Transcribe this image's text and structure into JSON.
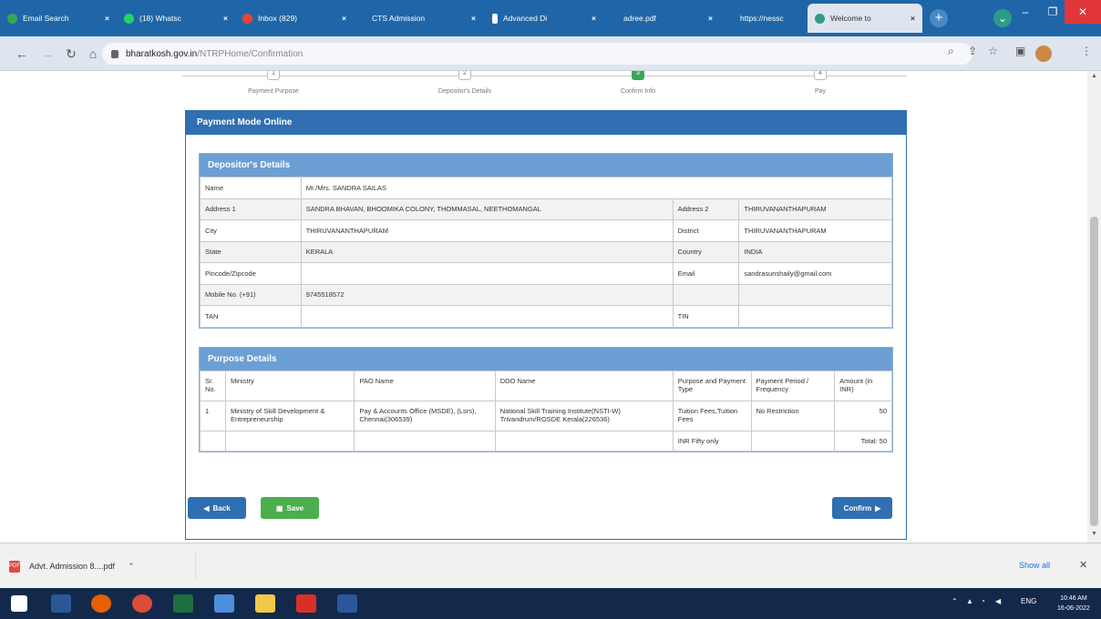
{
  "browser": {
    "tabs": [
      {
        "label": "Email Search",
        "active": false,
        "color": "#34a853"
      },
      {
        "label": "(18) Whatsc",
        "active": false,
        "color": "#25d366"
      },
      {
        "label": "Inbox (829)",
        "active": false,
        "color": "#ea4335"
      },
      {
        "label": "CTS Admission",
        "active": false,
        "color": "#ffffff"
      },
      {
        "label": "Advanced Di",
        "active": false,
        "color": "#ffffff"
      },
      {
        "label": "adree.pdf",
        "active": false,
        "color": "#ffffff"
      },
      {
        "label": "https://nessc",
        "active": false,
        "color": "#ffffff"
      },
      {
        "label": "Welcome to",
        "active": true,
        "color": "#2e9a8a"
      }
    ],
    "url_host": "bharatkosh.gov.in",
    "url_path": "/NTRPHome/Confirmation"
  },
  "stepper": {
    "steps": [
      {
        "num": "1",
        "label": "Payment Purpose"
      },
      {
        "num": "2",
        "label": "Depositor's Details"
      },
      {
        "num": "3",
        "label": "Confirm Info"
      },
      {
        "num": "4",
        "label": "Pay"
      }
    ]
  },
  "panel": {
    "title": "Payment Mode Online",
    "depositor": {
      "title": "Depositor's Details",
      "name_label": "Name",
      "name_value": "Mr./Mrs. SANDRA SAILAS",
      "address1_label": "Address 1",
      "address1_value": "SANDRA BHAVAN, BHOOMIKA COLONY, THOMMASAL, NEETHOMANGAL",
      "address2_label": "Address 2",
      "address2_value": "THIRUVANANTHAPURAM",
      "city_label": "City",
      "city_value": "THIRUVANANTHAPURAM",
      "district_label": "District",
      "district_value": "THIRUVANANTHAPURAM",
      "state_label": "State",
      "state_value": "KERALA",
      "country_label": "Country",
      "country_value": "INDIA",
      "pincode_label": "Pincode/Zipcode",
      "pincode_value": "",
      "email_label": "Email",
      "email_value": "sandrasunshaily@gmail.com",
      "mobile_label": "Mobile No. (+91)",
      "mobile_value": "9745518572",
      "tan_label": "TAN",
      "tan_value": "",
      "tin_label": "TIN",
      "tin_value": ""
    },
    "purpose": {
      "title": "Purpose Details",
      "headers": [
        "Sr. No.",
        "Ministry",
        "PAO Name",
        "DDO Name",
        "Purpose and Payment Type",
        "Payment Period / Frequency",
        "Amount (in INR)"
      ],
      "rows": [
        {
          "sr": "1",
          "ministry": "Ministry of Skill Development & Entrepreneurship",
          "pao": "Pay & Accounts Office (MSDE), (Lsrs), Chennai(306539)",
          "ddo": "National Skill Training Institute(NSTI-W) Trivandrum/ROSDE Kerala(226536)",
          "purpose": "Tuition Fees,Tuition Fees",
          "period": "No Restriction",
          "amount": "50"
        }
      ],
      "total_words": "INR Fifty only",
      "total_amount": "Total: 50"
    },
    "buttons": {
      "back": "Back",
      "save": "Save",
      "confirm": "Confirm"
    }
  },
  "download": {
    "file": "Advt. Admission 8....pdf",
    "show_all": "Show all"
  },
  "taskbar": {
    "lang": "ENG",
    "time": "10:46 AM",
    "date": "16-06-2022"
  }
}
